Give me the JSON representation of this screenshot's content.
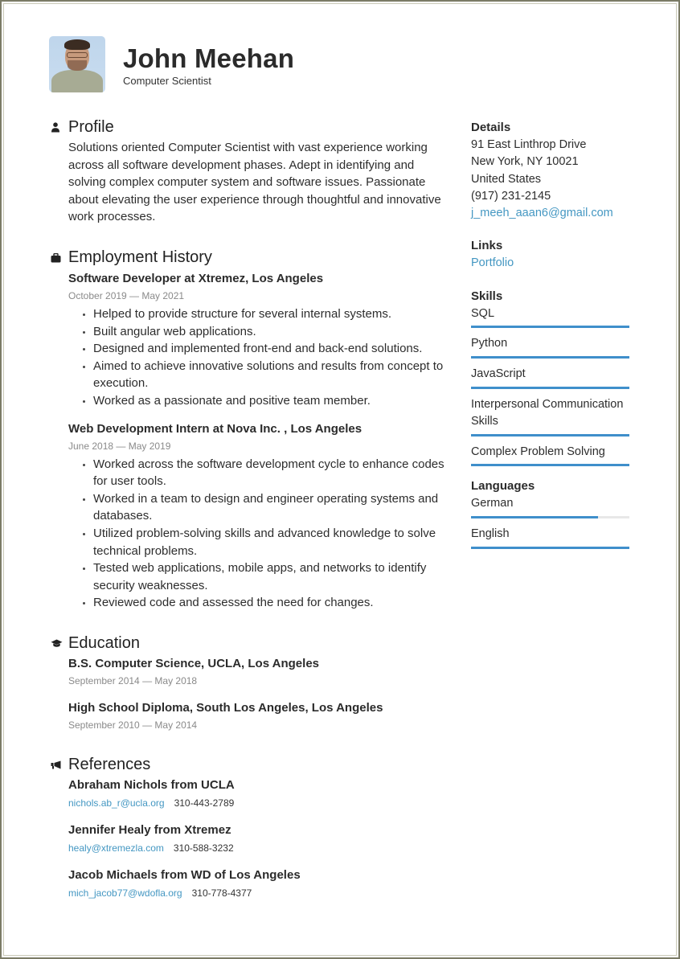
{
  "header": {
    "name": "John Meehan",
    "title": "Computer Scientist"
  },
  "profile": {
    "heading": "Profile",
    "icon": "person-icon",
    "text": "Solutions oriented Computer Scientist with vast experience working across all software development phases. Adept in identifying and solving complex computer system and software issues. Passionate about elevating the user experience through thoughtful and innovative work processes."
  },
  "employment": {
    "heading": "Employment History",
    "icon": "briefcase-icon",
    "jobs": [
      {
        "title": "Software Developer  at Xtremez, Los Angeles",
        "dates": "October 2019 — May 2021",
        "bullets": [
          "Helped to provide structure for several internal systems.",
          "Built angular web applications.",
          "Designed and implemented front-end and back-end solutions.",
          "Aimed to achieve innovative solutions and results from concept to execution.",
          "Worked as a passionate and positive team member."
        ]
      },
      {
        "title": "Web Development Intern at Nova Inc. , Los Angeles",
        "dates": "June 2018 — May 2019",
        "bullets": [
          "Worked across the software development cycle to enhance codes for user tools.",
          "Worked in a team to design and engineer operating systems and databases.",
          "Utilized problem-solving skills and advanced knowledge to solve technical problems.",
          "Tested web applications, mobile apps, and networks to identify security weaknesses.",
          "Reviewed code and assessed the need for changes."
        ]
      }
    ]
  },
  "education": {
    "heading": "Education",
    "icon": "graduation-cap-icon",
    "entries": [
      {
        "title": "B.S. Computer Science, UCLA, Los Angeles",
        "dates": "September 2014 — May 2018"
      },
      {
        "title": "High School Diploma, South Los Angeles, Los Angeles",
        "dates": "September 2010 — May 2014"
      }
    ]
  },
  "references": {
    "heading": "References",
    "icon": "megaphone-icon",
    "entries": [
      {
        "name": "Abraham Nichols from UCLA",
        "email": "nichols.ab_r@ucla.org",
        "phone": "310-443-2789"
      },
      {
        "name": "Jennifer Healy from Xtremez",
        "email": "healy@xtremezla.com",
        "phone": "310-588-3232"
      },
      {
        "name": "Jacob Michaels from WD of Los Angeles",
        "email": "mich_jacob77@wdofla.org",
        "phone": "310-778-4377"
      }
    ]
  },
  "details": {
    "heading": "Details",
    "address_line1": "91 East Linthrop Drive",
    "address_line2": "New York, NY 10021",
    "country": "United States",
    "phone": "(917) 231-2145",
    "email": "j_meeh_aaan6@gmail.com"
  },
  "links": {
    "heading": "Links",
    "items": [
      {
        "label": "Portfolio"
      }
    ]
  },
  "skills": {
    "heading": "Skills",
    "items": [
      {
        "name": "SQL",
        "level": 1.0
      },
      {
        "name": "Python",
        "level": 1.0
      },
      {
        "name": "JavaScript",
        "level": 1.0
      },
      {
        "name": "Interpersonal Communication Skills",
        "level": 1.0
      },
      {
        "name": "Complex Problem Solving",
        "level": 1.0
      }
    ]
  },
  "languages": {
    "heading": "Languages",
    "items": [
      {
        "name": "German",
        "level": 0.8
      },
      {
        "name": "English",
        "level": 1.0
      }
    ]
  },
  "colors": {
    "accent": "#3f8fcb",
    "link": "#4497c2",
    "text": "#2b2b2b",
    "muted": "#8a8a8a",
    "frame": "#7b7b66"
  }
}
